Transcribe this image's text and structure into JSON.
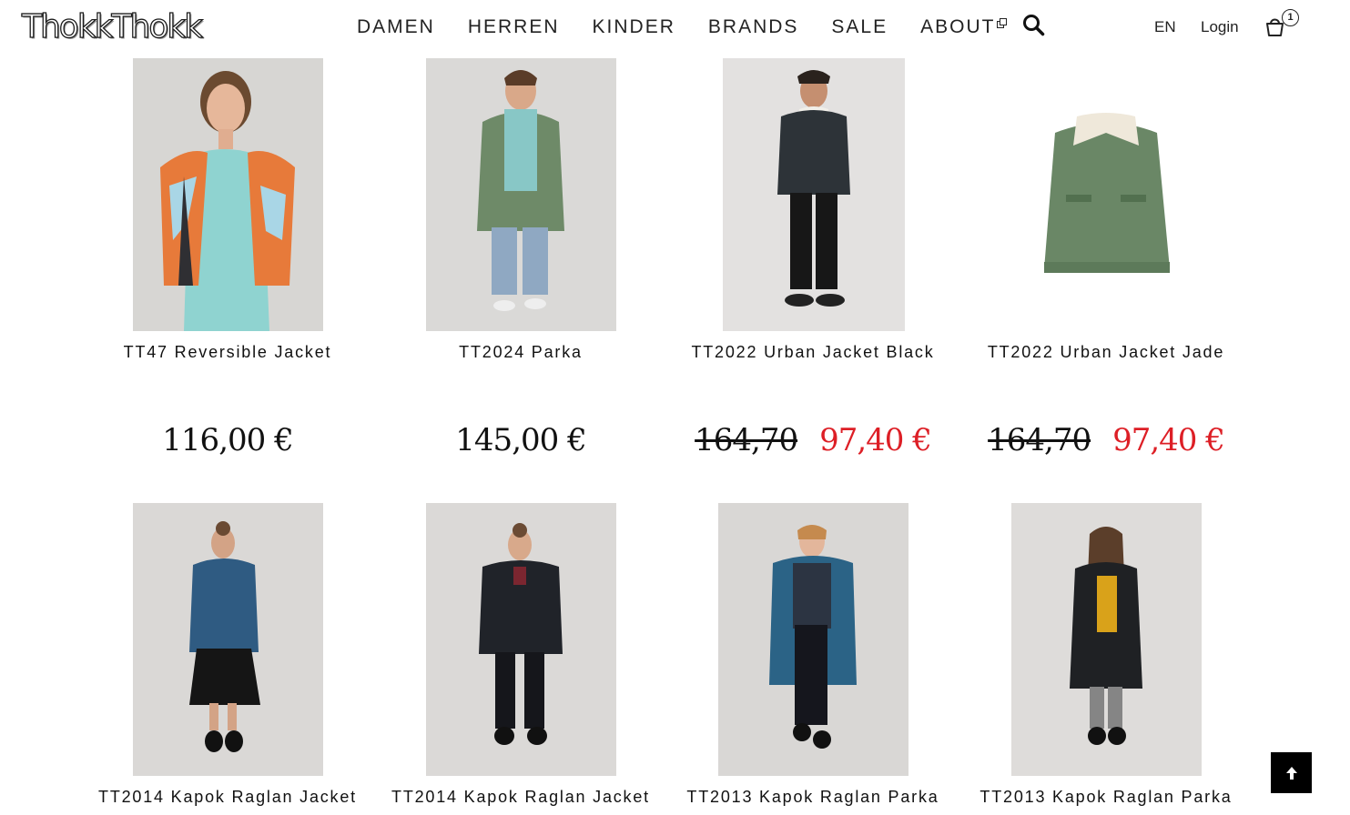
{
  "brand": {
    "logo_text": "ThokkThokk"
  },
  "nav": {
    "items": [
      {
        "label": "DAMEN"
      },
      {
        "label": "HERREN"
      },
      {
        "label": "KINDER"
      },
      {
        "label": "BRANDS"
      },
      {
        "label": "SALE"
      },
      {
        "label": "ABOUT",
        "external": true
      }
    ],
    "search_icon": "search-icon"
  },
  "header_right": {
    "language": "EN",
    "login": "Login",
    "cart_count": "1",
    "cart_icon": "cart-icon"
  },
  "products": [
    {
      "name": "TT47 Reversible Jacket",
      "price": "116,00 €"
    },
    {
      "name": "TT2024 Parka",
      "price": "145,00 €"
    },
    {
      "name": "TT2022 Urban Jacket Black",
      "old_price": "164,70",
      "price": "97,40 €"
    },
    {
      "name": "TT2022 Urban Jacket Jade",
      "old_price": "164,70",
      "price": "97,40 €"
    },
    {
      "name": "TT2014 Kapok Raglan Jacket"
    },
    {
      "name": "TT2014 Kapok Raglan Jacket"
    },
    {
      "name": "TT2013 Kapok Raglan Parka"
    },
    {
      "name": "TT2013 Kapok Raglan Parka"
    }
  ],
  "colors": {
    "sale_price": "#dd1f26",
    "text": "#111111",
    "photo_background": "#e2e0df",
    "back_to_top": "#000000"
  },
  "back_to_top_icon": "arrow-up-icon"
}
